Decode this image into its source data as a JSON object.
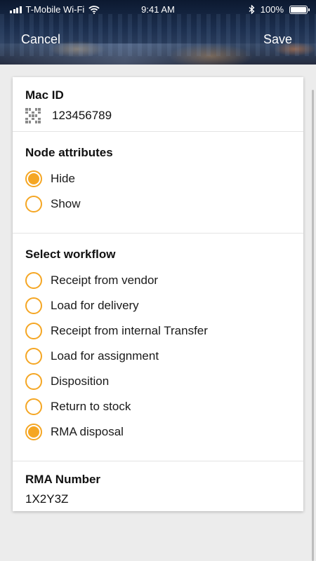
{
  "status": {
    "carrier": "T-Mobile Wi-Fi",
    "time": "9:41 AM",
    "battery": "100%"
  },
  "nav": {
    "cancel_label": "Cancel",
    "save_label": "Save"
  },
  "mac": {
    "title": "Mac ID",
    "value": "123456789",
    "icon": "qr-code-icon"
  },
  "node_attributes": {
    "title": "Node attributes",
    "options": [
      {
        "label": "Hide",
        "checked": true
      },
      {
        "label": "Show",
        "checked": false
      }
    ]
  },
  "workflow": {
    "title": "Select workflow",
    "options": [
      {
        "label": "Receipt from vendor",
        "checked": false
      },
      {
        "label": "Load for delivery",
        "checked": false
      },
      {
        "label": "Receipt from internal Transfer",
        "checked": false
      },
      {
        "label": "Load for assignment",
        "checked": false
      },
      {
        "label": "Disposition",
        "checked": false
      },
      {
        "label": "Return to stock",
        "checked": false
      },
      {
        "label": "RMA disposal",
        "checked": true
      }
    ]
  },
  "rma": {
    "title": "RMA Number",
    "value": "1X2Y3Z"
  },
  "colors": {
    "accent": "#f5a623"
  }
}
